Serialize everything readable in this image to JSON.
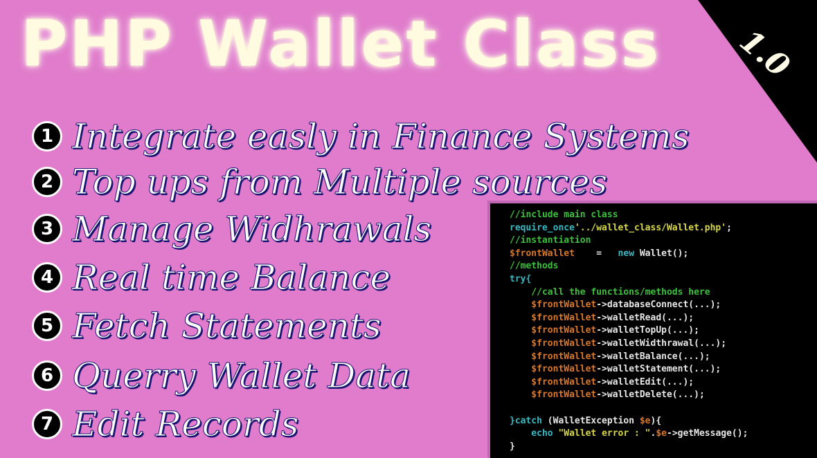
{
  "title": "PHP Wallet Class",
  "version": "1.0",
  "features": [
    {
      "num": "1",
      "text": "Integrate easly in Finance Systems"
    },
    {
      "num": "2",
      "text": "Top ups from Multiple sources"
    },
    {
      "num": "3",
      "text": "Manage Widhrawals"
    },
    {
      "num": "4",
      "text": "Real time Balance"
    },
    {
      "num": "5",
      "text": "Fetch Statements"
    },
    {
      "num": "6",
      "text": "Querry Wallet Data"
    },
    {
      "num": "7",
      "text": "Edit Records"
    }
  ],
  "code": {
    "l1": "//include main class",
    "l2a": "require_once",
    "l2b": "'../wallet_class/Wallet.php'",
    "l2c": ";",
    "l3": "//instantiation",
    "l4a": "$frontWallet",
    "l4b": "    =   ",
    "l4c": "new",
    "l4d": " Wallet();",
    "l5": "//methods",
    "l6": "try{",
    "l7": "    //call the functions/methods here",
    "var": "    $frontWallet",
    "m1": "->databaseConnect(...);",
    "m2": "->walletRead(...);",
    "m3": "->walletTopUp(...);",
    "m4": "->walletWidthrawal(...);",
    "m5": "->walletBalance(...);",
    "m6": "->walletStatement(...);",
    "m7": "->walletEdit(...);",
    "m8": "->walletDelete(...);",
    "c1": "}catch",
    "c2": " (WalletException ",
    "c3": "$e",
    "c4": "){",
    "e1": "    echo",
    "e2": " \"Wallet error : \"",
    "e3": ".",
    "e4": "$e",
    "e5": "->getMessage();",
    "end": "}"
  }
}
